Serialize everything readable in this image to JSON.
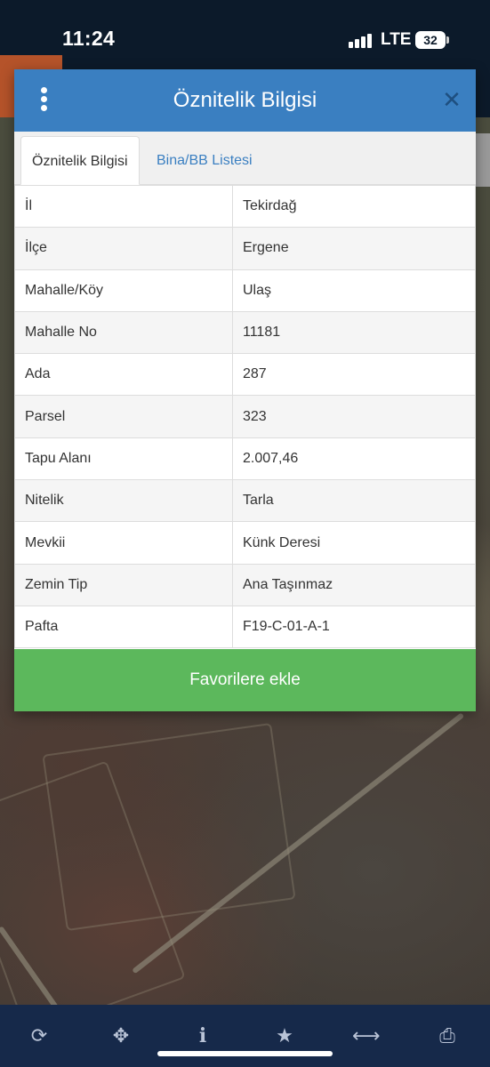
{
  "status_bar": {
    "time": "11:24",
    "network": "LTE",
    "battery": "32"
  },
  "modal": {
    "title": "Öznitelik Bilgisi",
    "close_icon": "close-icon",
    "menu_icon": "vertical-dots-icon",
    "tabs": [
      {
        "label": "Öznitelik Bilgisi",
        "active": true
      },
      {
        "label": "Bina/BB Listesi",
        "active": false
      }
    ],
    "rows": [
      {
        "key": "İl",
        "value": "Tekirdağ"
      },
      {
        "key": "İlçe",
        "value": "Ergene"
      },
      {
        "key": "Mahalle/Köy",
        "value": "Ulaş"
      },
      {
        "key": "Mahalle No",
        "value": "11181"
      },
      {
        "key": "Ada",
        "value": "287"
      },
      {
        "key": "Parsel",
        "value": "323"
      },
      {
        "key": "Tapu Alanı",
        "value": "2.007,46"
      },
      {
        "key": "Nitelik",
        "value": "Tarla"
      },
      {
        "key": "Mevkii",
        "value": "Künk Deresi"
      },
      {
        "key": "Zemin Tip",
        "value": "Ana Taşınmaz"
      },
      {
        "key": "Pafta",
        "value": "F19-C-01-A-1"
      }
    ],
    "favorite_button": "Favorilere ekle"
  },
  "toolbar": {
    "icons": [
      "refresh-icon",
      "locate-crosshair-icon",
      "info-icon",
      "star-icon",
      "measure-arrows-icon",
      "print-icon"
    ]
  },
  "colors": {
    "header_blue": "#3a7fc1",
    "button_green": "#5cb85c",
    "toolbar_navy": "#16294a"
  }
}
